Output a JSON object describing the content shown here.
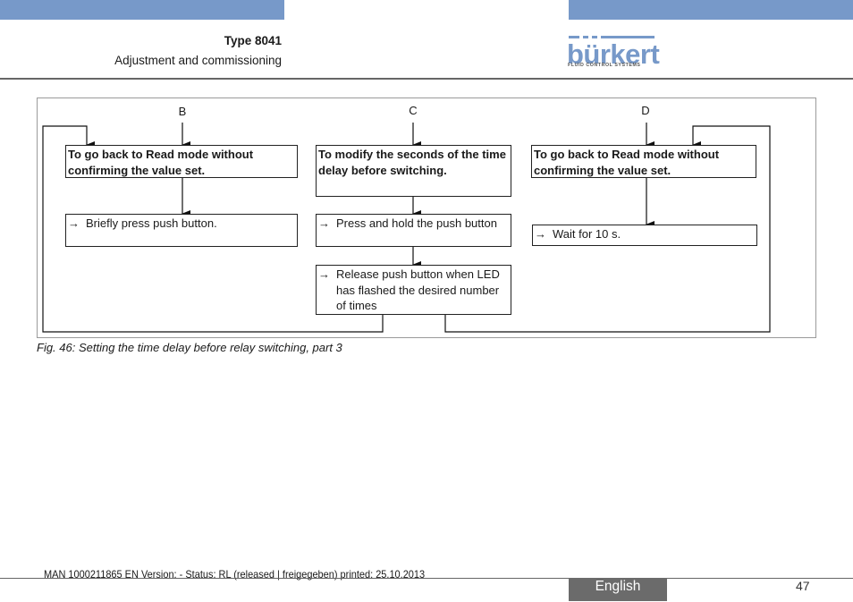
{
  "header": {
    "title": "Type 8041",
    "subtitle": "Adjustment and commissioning",
    "logo_word": "bürkert",
    "logo_tagline": "FLUID CONTROL SYSTEMS",
    "accent_color": "#7799c9"
  },
  "figure": {
    "entry_labels": [
      "B",
      "C",
      "D"
    ],
    "column_b": {
      "header": "To go back to Read mode without confirming the value set.",
      "steps": [
        "Briefly press push button."
      ]
    },
    "column_c": {
      "header": "To modify the seconds of the time delay before switching.",
      "steps": [
        "Press and hold the push button",
        "Release push button when LED has flashed the desired number of times"
      ]
    },
    "column_d": {
      "header": "To go back to Read mode without confirming the value set.",
      "steps": [
        "Wait for 10 s."
      ]
    },
    "step_arrow": "→",
    "caption": "Fig. 46:  Setting the time delay before relay switching, part 3"
  },
  "footer": {
    "document_meta": "MAN  1000211865  EN  Version: - Status: RL (released | freigegeben)  printed: 25.10.2013",
    "language": "English",
    "page_number": "47"
  }
}
